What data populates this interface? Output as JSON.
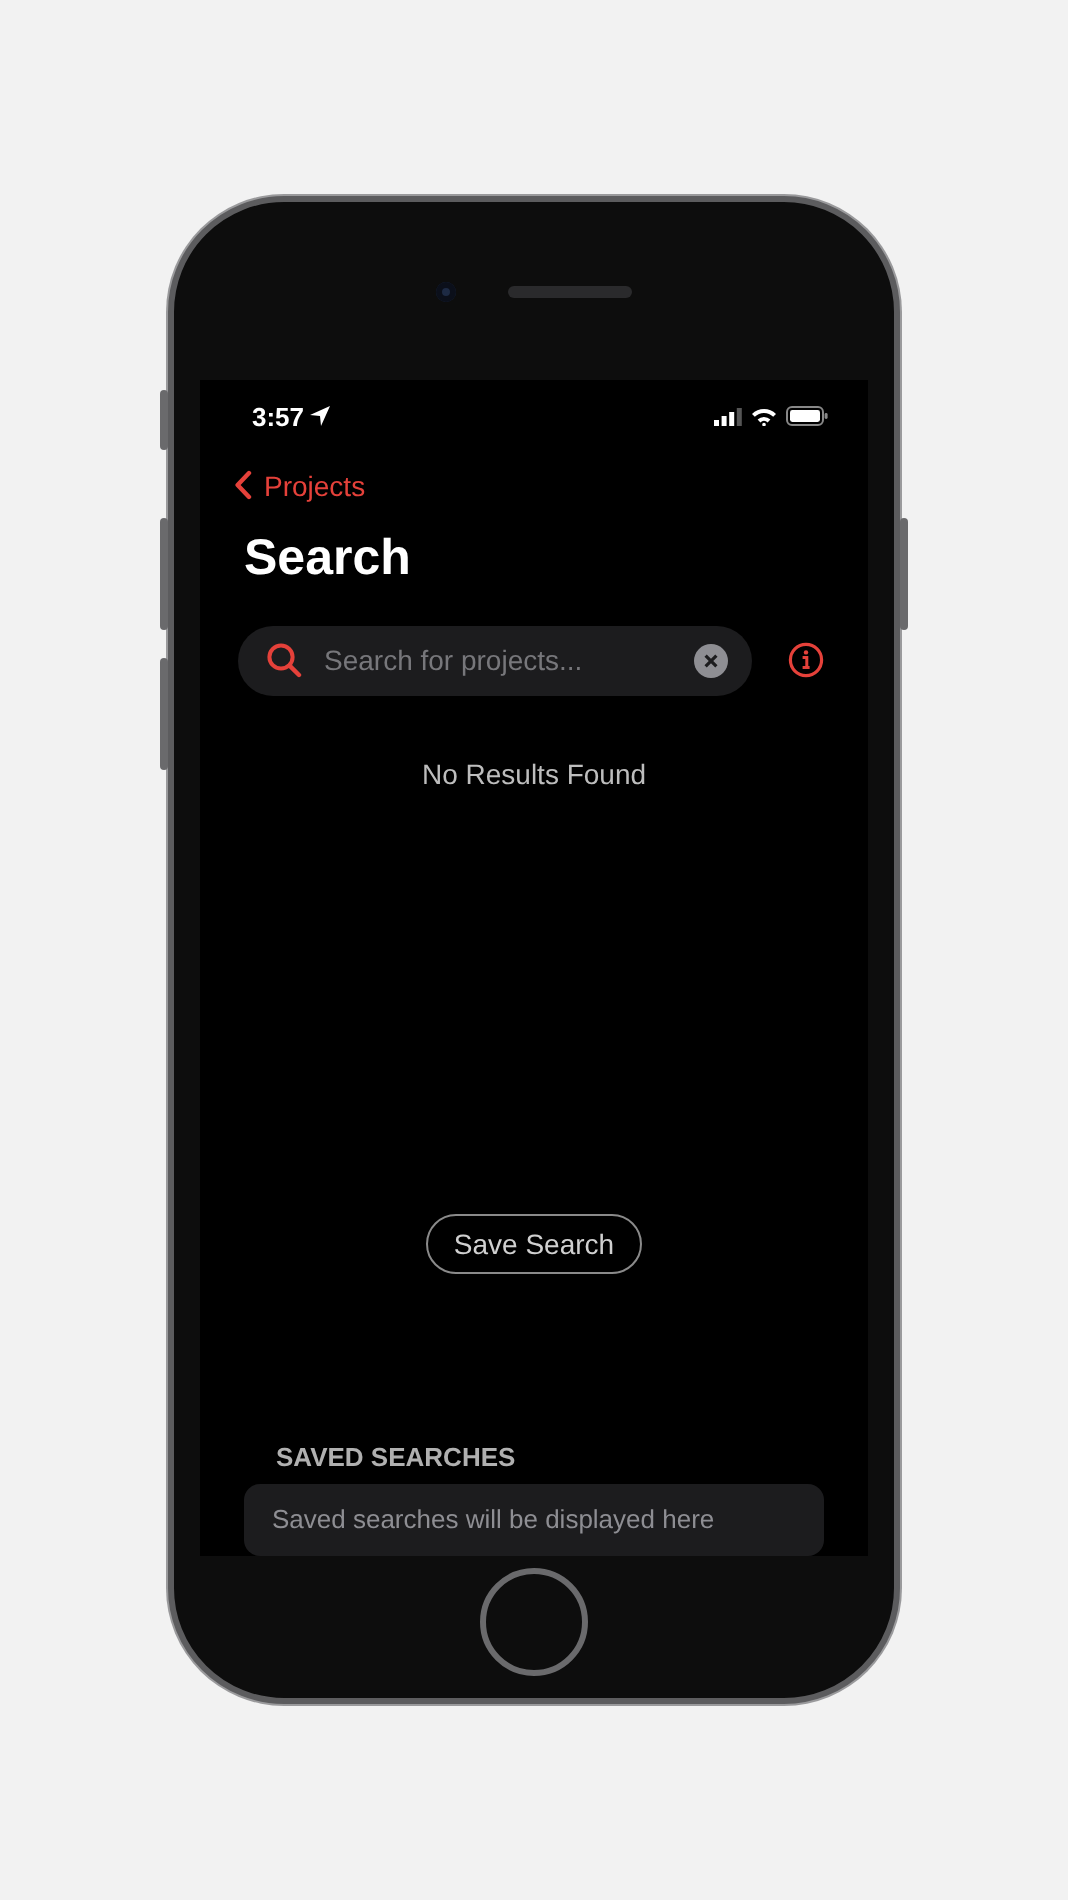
{
  "status_bar": {
    "time": "3:57"
  },
  "nav": {
    "back_label": "Projects",
    "title": "Search"
  },
  "search": {
    "placeholder": "Search for projects..."
  },
  "empty_message": "No Results Found",
  "save_button": "Save Search",
  "saved_searches": {
    "heading": "SAVED SEARCHES",
    "empty_text": "Saved searches will be displayed here"
  }
}
